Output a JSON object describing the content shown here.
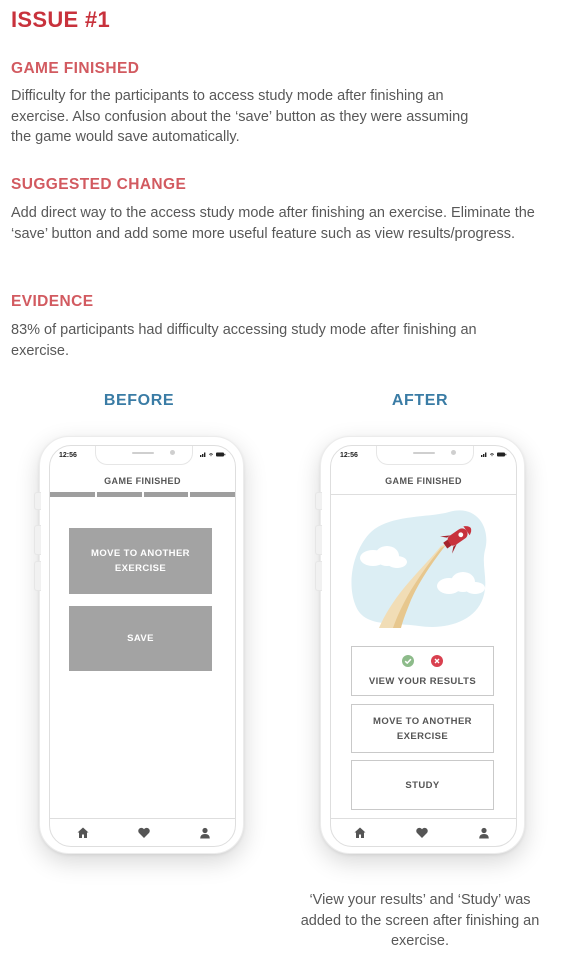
{
  "issue_title": "ISSUE #1",
  "sections": [
    {
      "heading": "GAME FINISHED",
      "body": "Difficulty for the participants to access study mode after finishing an exercise. Also confusion about the ‘save’ button as they were assuming the game would save automatically."
    },
    {
      "heading": "SUGGESTED CHANGE",
      "body": "Add direct way to the access study mode after finishing an exercise. Eliminate the ‘save’ button and add some more useful feature such as view results/progress."
    },
    {
      "heading": "EVIDENCE",
      "body": "83% of participants had difficulty accessing study mode after finishing an exercise."
    }
  ],
  "before": {
    "label": "BEFORE",
    "time": "12:56",
    "screen_title": "GAME FINISHED",
    "buttons": [
      "MOVE TO ANOTHER EXERCISE",
      "SAVE"
    ]
  },
  "after": {
    "label": "AFTER",
    "time": "12:56",
    "screen_title": "GAME FINISHED",
    "view_results": "VIEW YOUR RESULTS",
    "move_to": "MOVE TO ANOTHER EXERCISE",
    "study": "STUDY"
  },
  "caption": "‘View your results’ and ‘Study’ was added to the screen after finishing an exercise.",
  "colors": {
    "issue": "#c8323c",
    "heading": "#d25a60",
    "column_heading": "#3a7ca5",
    "gray_button": "#a3a3a3",
    "check_green": "#8dbb8a",
    "cross_red": "#d9404f",
    "rocket_red": "#c8323c"
  },
  "icons": [
    "home-icon",
    "heart-icon",
    "user-icon",
    "check-circle-icon",
    "x-circle-icon",
    "rocket-illustration",
    "signal-icon",
    "wifi-icon",
    "battery-icon"
  ]
}
